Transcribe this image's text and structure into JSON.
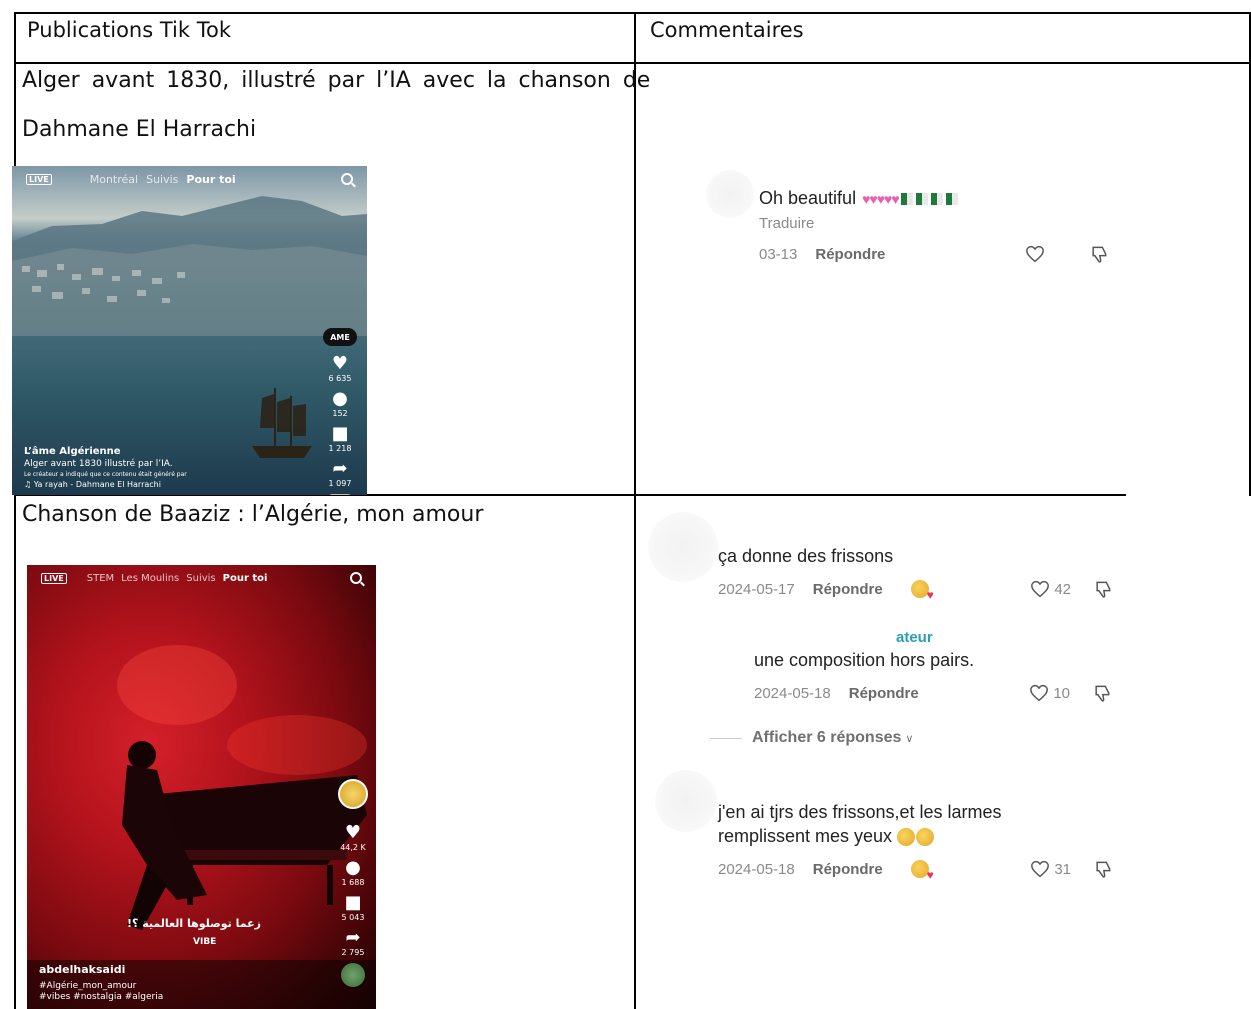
{
  "table": {
    "col1_header": "Publications Tik Tok",
    "col2_header": "Commentaires",
    "row1_title_line1": "Alger avant 1830, illustré par l’IA avec la chanson de",
    "row1_title_line2": "Dahmane El Harrachi",
    "row2_title": "Chanson de Baaziz : l’Algérie, mon amour"
  },
  "post1": {
    "live": "LIVE",
    "nav": [
      "Montréal",
      "Suivis",
      "Pour toi"
    ],
    "avatar_label": "AME",
    "likes": "6 635",
    "comments": "152",
    "saves": "1 218",
    "shares": "1 097",
    "author": "L’âme Algérienne",
    "description": "Alger avant 1830 illustré par l’IA.",
    "ai_notice": "Le créateur a indiqué que ce contenu était généré par",
    "music": "♫ Ya rayah - Dahmane El Harrachi"
  },
  "post2": {
    "live": "LIVE",
    "nav": [
      "STEM",
      "Les Moulins",
      "Suivis",
      "Pour toi"
    ],
    "likes": "44,2 K",
    "comments": "1 688",
    "saves": "5 043",
    "shares": "2 795",
    "overlay_arabic": "زعما توصلوها العالمية ؟!",
    "vibe": "VIBE",
    "author": "abdelhaksaidi",
    "hashtags_line1": "#Algérie_mon_amour",
    "hashtags_line2": "#vibes #nostalgia #algeria"
  },
  "comment1": {
    "text": "Oh beautiful",
    "translate": "Traduire",
    "date": "03-13",
    "reply": "Répondre"
  },
  "comment2": {
    "text": "ça donne des frissons",
    "date": "2024-05-17",
    "reply": "Répondre",
    "likes": "42"
  },
  "comment3": {
    "badge": "ateur",
    "text": "une composition hors pairs.",
    "date": "2024-05-18",
    "reply": "Répondre",
    "likes": "10"
  },
  "show_replies": "Afficher 6 réponses",
  "comment4": {
    "text_line1": "j'en ai tjrs des frissons,et les larmes",
    "text_line2": "remplissent mes yeux",
    "date": "2024-05-18",
    "reply": "Répondre",
    "likes": "31"
  },
  "colors": {
    "border": "#000000",
    "tiktok_red": "#fe2c55",
    "teal_badge": "#2a9fb5"
  }
}
